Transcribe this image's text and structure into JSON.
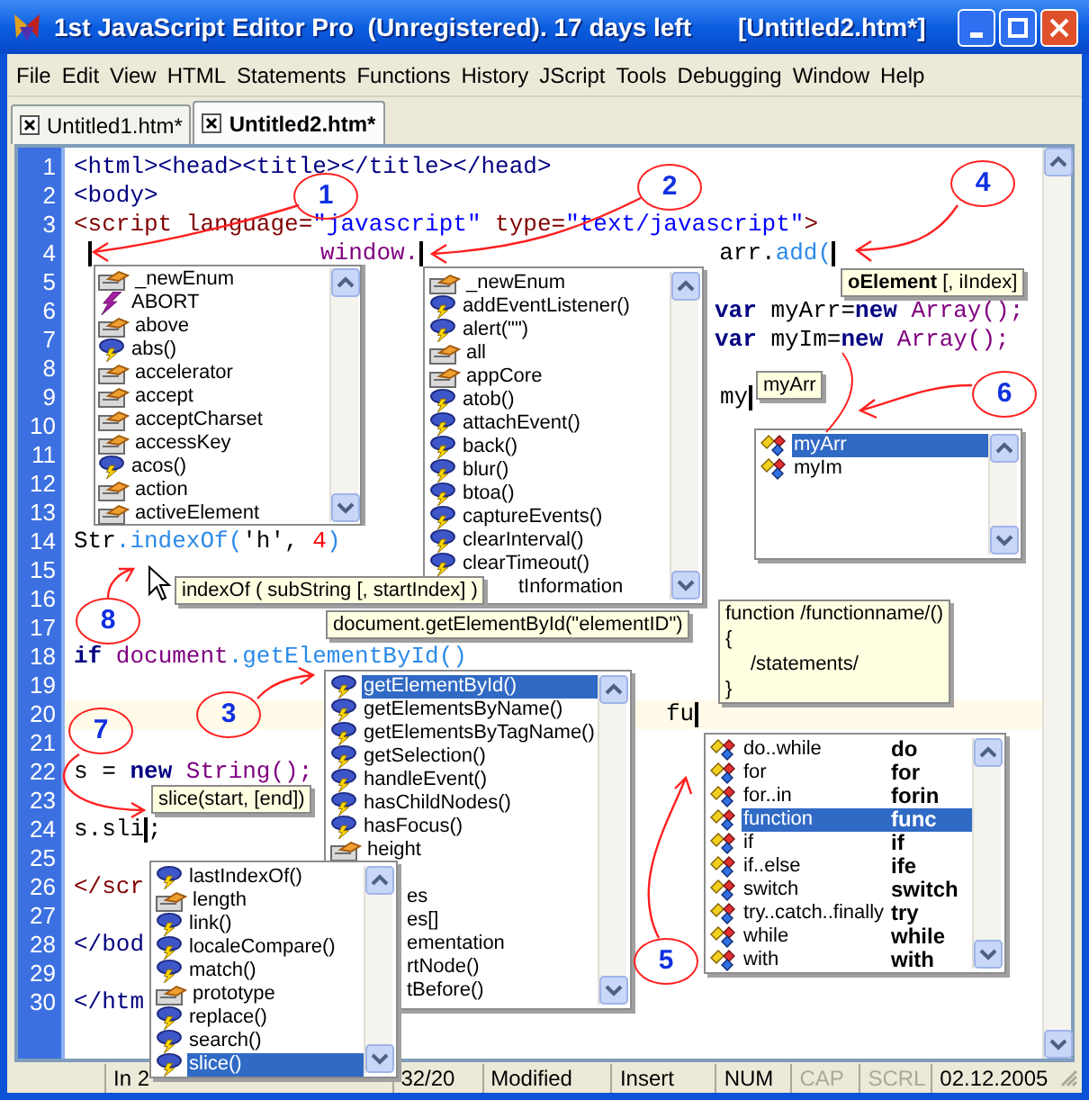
{
  "window": {
    "title": "1st JavaScript Editor Pro  (Unregistered). 17 days left",
    "document": "[Untitled2.htm*]"
  },
  "menu": [
    "File",
    "Edit",
    "View",
    "HTML",
    "Statements",
    "Functions",
    "History",
    "JScript",
    "Tools",
    "Debugging",
    "Window",
    "Help"
  ],
  "tabs": [
    {
      "label": "Untitled1.htm*",
      "selected": false
    },
    {
      "label": "Untitled2.htm*",
      "selected": true
    }
  ],
  "editor": {
    "lines": [
      {
        "number": "1",
        "current": false,
        "chunks": [
          [
            {
              "kind": "tag",
              "text": "<html><head><title></title></head>"
            }
          ]
        ]
      },
      {
        "number": "2",
        "current": false,
        "chunks": [
          [
            {
              "kind": "tag",
              "text": "<body>"
            }
          ]
        ]
      },
      {
        "number": "3",
        "current": false,
        "chunks": [
          [
            {
              "kind": "script",
              "text": "<script language="
            },
            {
              "kind": "string",
              "text": "\"javascript\""
            },
            {
              "kind": "script",
              "text": " type="
            },
            {
              "kind": "string",
              "text": "\"text/javascript\""
            },
            {
              "kind": "script",
              "text": ">"
            }
          ]
        ]
      },
      {
        "number": "4",
        "current": false,
        "chunks": [
          [
            {
              "kind": "caret"
            }
          ],
          [
            {
              "kind": "object",
              "text": "window."
            },
            {
              "kind": "caret"
            }
          ],
          [
            {
              "kind": "plain",
              "text": "arr."
            },
            {
              "kind": "method",
              "text": "add("
            },
            {
              "kind": "caret"
            }
          ]
        ]
      },
      {
        "number": "5",
        "current": false
      },
      {
        "number": "6",
        "current": false,
        "chunks": [
          [
            {
              "kind": "keyword",
              "text": "var"
            },
            {
              "kind": "plain",
              "text": " myArr="
            },
            {
              "kind": "keyword",
              "text": "new"
            },
            {
              "kind": "object",
              "text": " Array();"
            }
          ]
        ]
      },
      {
        "number": "7",
        "current": false,
        "chunks": [
          [
            {
              "kind": "keyword",
              "text": "var"
            },
            {
              "kind": "plain",
              "text": " myIm="
            },
            {
              "kind": "keyword",
              "text": "new"
            },
            {
              "kind": "object",
              "text": " Array();"
            }
          ]
        ]
      },
      {
        "number": "8",
        "current": false
      },
      {
        "number": "9",
        "current": false,
        "chunks": [
          [
            {
              "kind": "plain",
              "text": "my"
            },
            {
              "kind": "caret"
            }
          ]
        ]
      },
      {
        "number": "10",
        "current": false
      },
      {
        "number": "11",
        "current": false
      },
      {
        "number": "12",
        "current": false
      },
      {
        "number": "13",
        "current": false
      },
      {
        "number": "14",
        "current": false,
        "chunks": [
          [
            {
              "kind": "plain",
              "text": "Str"
            },
            {
              "kind": "method",
              "text": ".indexOf("
            },
            {
              "kind": "plain",
              "text": "'h', "
            },
            {
              "kind": "number",
              "text": "4"
            },
            {
              "kind": "method",
              "text": ")"
            }
          ]
        ]
      },
      {
        "number": "15",
        "current": false
      },
      {
        "number": "16",
        "current": false
      },
      {
        "number": "17",
        "current": false
      },
      {
        "number": "18",
        "current": false,
        "chunks": [
          [
            {
              "kind": "keyword",
              "text": "if"
            },
            {
              "kind": "object",
              "text": " document"
            },
            {
              "kind": "method",
              "text": ".getElementById()"
            }
          ]
        ]
      },
      {
        "number": "19",
        "current": false
      },
      {
        "number": "20",
        "current": true,
        "chunks": [
          [
            {
              "kind": "plain",
              "text": "fu"
            },
            {
              "kind": "caret"
            }
          ]
        ]
      },
      {
        "number": "21",
        "current": false
      },
      {
        "number": "22",
        "current": false,
        "chunks": [
          [
            {
              "kind": "plain",
              "text": "s = "
            },
            {
              "kind": "keyword",
              "text": "new"
            },
            {
              "kind": "object",
              "text": " String();"
            }
          ]
        ]
      },
      {
        "number": "23",
        "current": false
      },
      {
        "number": "24",
        "current": false,
        "chunks": [
          [
            {
              "kind": "plain",
              "text": "s.sli"
            },
            {
              "kind": "caret"
            },
            {
              "kind": "plain",
              "text": ";"
            }
          ]
        ]
      },
      {
        "number": "25",
        "current": false
      },
      {
        "number": "26",
        "current": false,
        "chunks": [
          [
            {
              "kind": "script",
              "text": "</scr"
            }
          ]
        ]
      },
      {
        "number": "27",
        "current": false
      },
      {
        "number": "28",
        "current": false,
        "chunks": [
          [
            {
              "kind": "tag",
              "text": "</bod"
            }
          ]
        ]
      },
      {
        "number": "29",
        "current": false
      },
      {
        "number": "30",
        "current": false,
        "chunks": [
          [
            {
              "kind": "tag",
              "text": "</htm"
            }
          ]
        ]
      }
    ]
  },
  "completion_lists": [
    {
      "items": [
        {
          "label": "_newEnum",
          "kind": "property",
          "selected": false
        },
        {
          "label": "ABORT",
          "kind": "constant",
          "selected": false
        },
        {
          "label": "above",
          "kind": "property",
          "selected": false
        },
        {
          "label": "abs()",
          "kind": "method",
          "selected": false
        },
        {
          "label": "accelerator",
          "kind": "property",
          "selected": false
        },
        {
          "label": "accept",
          "kind": "property",
          "selected": false
        },
        {
          "label": "acceptCharset",
          "kind": "property",
          "selected": false
        },
        {
          "label": "accessKey",
          "kind": "property",
          "selected": false
        },
        {
          "label": "acos()",
          "kind": "method",
          "selected": false
        },
        {
          "label": "action",
          "kind": "property",
          "selected": false
        },
        {
          "label": "activeElement",
          "kind": "property",
          "selected": false
        }
      ]
    },
    {
      "items": [
        {
          "label": "_newEnum",
          "kind": "property",
          "selected": false
        },
        {
          "label": "addEventListener()",
          "kind": "method",
          "selected": false
        },
        {
          "label": "alert(\"\")",
          "kind": "method",
          "selected": false
        },
        {
          "label": "all",
          "kind": "property",
          "selected": false
        },
        {
          "label": "appCore",
          "kind": "property",
          "selected": false
        },
        {
          "label": "atob()",
          "kind": "method",
          "selected": false
        },
        {
          "label": "attachEvent()",
          "kind": "method",
          "selected": false
        },
        {
          "label": "back()",
          "kind": "method",
          "selected": false
        },
        {
          "label": "blur()",
          "kind": "method",
          "selected": false
        },
        {
          "label": "btoa()",
          "kind": "method",
          "selected": false
        },
        {
          "label": "captureEvents()",
          "kind": "method",
          "selected": false
        },
        {
          "label": "clearInterval()",
          "kind": "method",
          "selected": false
        },
        {
          "label": "clearTimeout()",
          "kind": "method",
          "selected": false
        },
        {
          "label": "tInformation",
          "kind": "clipped",
          "selected": false
        }
      ]
    },
    {
      "items": [
        {
          "label": "myArr",
          "kind": "variable",
          "selected": true
        },
        {
          "label": "myIm",
          "kind": "variable",
          "selected": false
        }
      ]
    },
    {
      "items": [
        {
          "label": "getElementById()",
          "kind": "method",
          "selected": true
        },
        {
          "label": "getElementsByName()",
          "kind": "method",
          "selected": false
        },
        {
          "label": "getElementsByTagName()",
          "kind": "method",
          "selected": false
        },
        {
          "label": "getSelection()",
          "kind": "method",
          "selected": false
        },
        {
          "label": "handleEvent()",
          "kind": "method",
          "selected": false
        },
        {
          "label": "hasChildNodes()",
          "kind": "method",
          "selected": false
        },
        {
          "label": "hasFocus()",
          "kind": "method",
          "selected": false
        },
        {
          "label": "height",
          "kind": "property",
          "selected": false
        },
        {
          "label": "es",
          "kind": "clipped",
          "selected": false
        },
        {
          "label": "es[]",
          "kind": "clipped",
          "selected": false
        },
        {
          "label": "ementation",
          "kind": "clipped",
          "selected": false
        },
        {
          "label": "rtNode()",
          "kind": "clipped",
          "selected": false
        },
        {
          "label": "tBefore()",
          "kind": "clipped",
          "selected": false
        }
      ]
    },
    {
      "items": [
        {
          "label": "do..while",
          "shortcut": "do",
          "kind": "statement",
          "selected": false
        },
        {
          "label": "for",
          "shortcut": "for",
          "kind": "statement",
          "selected": false
        },
        {
          "label": "for..in",
          "shortcut": "forin",
          "kind": "statement",
          "selected": false
        },
        {
          "label": "function",
          "shortcut": "func",
          "kind": "statement",
          "selected": true
        },
        {
          "label": "if",
          "shortcut": "if",
          "kind": "statement",
          "selected": false
        },
        {
          "label": "if..else",
          "shortcut": "ife",
          "kind": "statement",
          "selected": false
        },
        {
          "label": "switch",
          "shortcut": "switch",
          "kind": "statement",
          "selected": false
        },
        {
          "label": "try..catch..finally",
          "shortcut": "try",
          "kind": "statement",
          "selected": false
        },
        {
          "label": "while",
          "shortcut": "while",
          "kind": "statement",
          "selected": false
        },
        {
          "label": "with",
          "shortcut": "with",
          "kind": "statement",
          "selected": false
        }
      ]
    },
    {
      "items": [
        {
          "label": "lastIndexOf()",
          "kind": "method",
          "selected": false
        },
        {
          "label": "length",
          "kind": "property",
          "selected": false
        },
        {
          "label": "link()",
          "kind": "method",
          "selected": false
        },
        {
          "label": "localeCompare()",
          "kind": "method",
          "selected": false
        },
        {
          "label": "match()",
          "kind": "method",
          "selected": false
        },
        {
          "label": "prototype",
          "kind": "property",
          "selected": false
        },
        {
          "label": "replace()",
          "kind": "method",
          "selected": false
        },
        {
          "label": "search()",
          "kind": "method",
          "selected": false
        },
        {
          "label": "slice()",
          "kind": "method",
          "selected": true
        }
      ]
    }
  ],
  "tooltips": [
    {
      "lines": [
        {
          "text": "**oElement** [, iIndex]",
          "indented": false
        }
      ]
    },
    {
      "lines": [
        {
          "text": "myArr",
          "indented": false
        }
      ]
    },
    {
      "lines": [
        {
          "text": "indexOf ( subString [, startIndex] )",
          "indented": false
        }
      ]
    },
    {
      "lines": [
        {
          "text": "function /functionname/()",
          "indented": false
        },
        {
          "text": "{",
          "indented": false
        },
        {
          "text": "/statements/",
          "indented": true
        },
        {
          "text": "}",
          "indented": false
        }
      ]
    },
    {
      "lines": [
        {
          "text": "document.getElementById(\"elementID\")",
          "indented": false
        }
      ]
    },
    {
      "lines": [
        {
          "text": "slice(start, [end])",
          "indented": false
        }
      ]
    }
  ],
  "annotations": [
    {
      "label": "1"
    },
    {
      "label": "2"
    },
    {
      "label": "4"
    },
    {
      "label": "6"
    },
    {
      "label": "8"
    },
    {
      "label": "3"
    },
    {
      "label": "7"
    },
    {
      "label": "5"
    }
  ],
  "status_bar": [
    {
      "text": "In 2",
      "enabled": true
    },
    {
      "text": "32/20",
      "enabled": true
    },
    {
      "text": "Modified",
      "enabled": true
    },
    {
      "text": "Insert",
      "enabled": true
    },
    {
      "text": "NUM",
      "enabled": true
    },
    {
      "text": "CAP",
      "enabled": false
    },
    {
      "text": "SCRL",
      "enabled": false
    },
    {
      "text": "02.12.2005",
      "enabled": true
    }
  ]
}
